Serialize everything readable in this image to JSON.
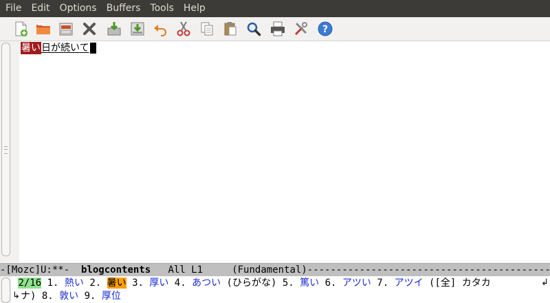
{
  "menu": [
    "File",
    "Edit",
    "Options",
    "Buffers",
    "Tools",
    "Help"
  ],
  "toolbar": {
    "icons": [
      "new-file-icon",
      "open-folder-icon",
      "dired-icon",
      "close-icon",
      "save-icon",
      "save-as-icon",
      "undo-icon",
      "cut-icon",
      "copy-icon",
      "paste-icon",
      "search-icon",
      "print-icon",
      "preferences-icon",
      "help-icon"
    ]
  },
  "buffer": {
    "preedit_highlighted": "暑い",
    "preedit_rest": "日が続いて"
  },
  "modeline": {
    "prefix": "-[Mozc]U:**-  ",
    "buffer_name": "blogcontents",
    "position": "   All L1     ",
    "mode": "(Fundamental)",
    "fill": "---------------------------------------------"
  },
  "candidates": {
    "counter": "2/16",
    "items": [
      {
        "num": "1.",
        "text": "熱い",
        "selected": false
      },
      {
        "num": "2.",
        "text": "暑い",
        "selected": true
      },
      {
        "num": "3.",
        "text": "厚い",
        "selected": false
      },
      {
        "num": "4.",
        "text": "あつい",
        "selected": false
      },
      {
        "num": "",
        "text": "(ひらがな)",
        "selected": false
      },
      {
        "num": "5.",
        "text": "篤い",
        "selected": false
      },
      {
        "num": "6.",
        "text": "アツい",
        "selected": false
      },
      {
        "num": "7.",
        "text": "アツイ",
        "selected": false
      },
      {
        "num": "",
        "text": "([全] カタカ",
        "selected": false
      }
    ],
    "line2_prefix": "ナ)",
    "line2_items": [
      {
        "num": "8.",
        "text": "敦い"
      },
      {
        "num": "9.",
        "text": "厚位"
      }
    ]
  }
}
